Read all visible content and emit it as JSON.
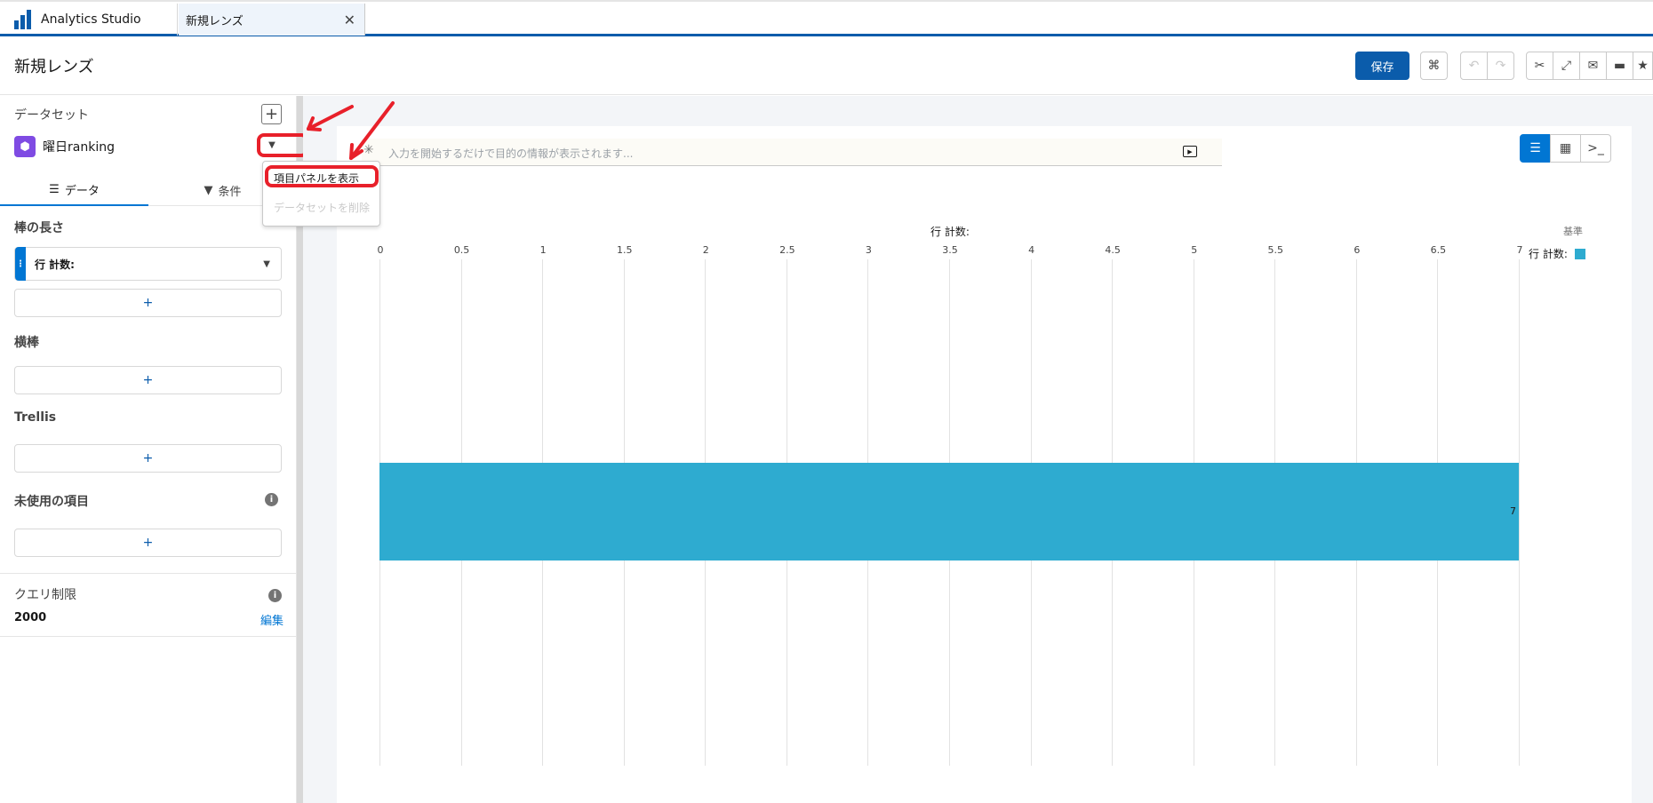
{
  "tabs": {
    "app_name": "Analytics Studio",
    "lens_tab": "新規レンズ"
  },
  "header": {
    "title": "新規レンズ",
    "save_label": "保存"
  },
  "sidebar": {
    "dataset_label": "データセット",
    "dataset_name": "曜日ranking",
    "tab_data": "データ",
    "tab_filter": "条件",
    "bar_length_label": "棒の長さ",
    "measure_field": "行 計数:",
    "bars_label": "横棒",
    "trellis_label": "Trellis",
    "unused_label": "未使用の項目",
    "query_limit_label": "クエリ制限",
    "query_limit_value": "2000",
    "edit_label": "編集",
    "add_symbol": "+"
  },
  "dropdown_menu": {
    "show_field_panel": "項目パネルを表示",
    "delete_dataset": "データセットを削除"
  },
  "search": {
    "placeholder": "入力を開始するだけで目的の情報が表示されます..."
  },
  "legend": {
    "title": "基準",
    "item": "行 計数:"
  },
  "annotation_color": "#e8202a",
  "chart_data": {
    "type": "bar",
    "orientation": "horizontal",
    "title": "行 計数:",
    "categories": [
      ""
    ],
    "values": [
      7
    ],
    "xlim": [
      0,
      7
    ],
    "ticks": [
      "0",
      "0.5",
      "1",
      "1.5",
      "2",
      "2.5",
      "3",
      "3.5",
      "4",
      "4.5",
      "5",
      "5.5",
      "6",
      "6.5",
      "7"
    ],
    "bar_label": "7",
    "color": "#2eabd0",
    "grid": true,
    "legend_position": "top-right"
  }
}
